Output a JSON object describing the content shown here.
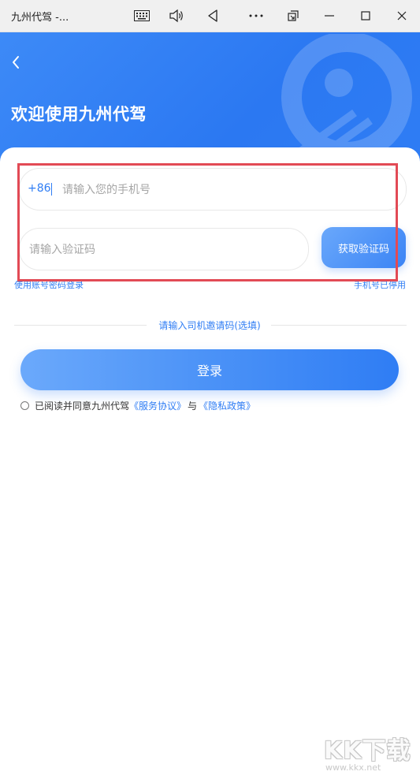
{
  "window": {
    "title": "九州代驾 -..."
  },
  "header": {
    "welcome": "欢迎使用九州代驾"
  },
  "form": {
    "prefix": "+86",
    "phone_placeholder": "请输入您的手机号",
    "code_placeholder": "请输入验证码",
    "get_code_label": "获取验证码",
    "link_left": "使用账号密码登录",
    "link_right": "手机号已停用",
    "invite_label": "请输入司机邀请码(选填)",
    "login_label": "登录"
  },
  "agreement": {
    "prefix": "已阅读并同意九州代驾",
    "service": "《服务协议》",
    "and": "与",
    "privacy": "《隐私政策》"
  },
  "site_watermark": {
    "brand": "KK下载",
    "url": "www.kkx.net"
  },
  "colors": {
    "primary": "#2f7df4",
    "highlight": "#e24a55"
  }
}
